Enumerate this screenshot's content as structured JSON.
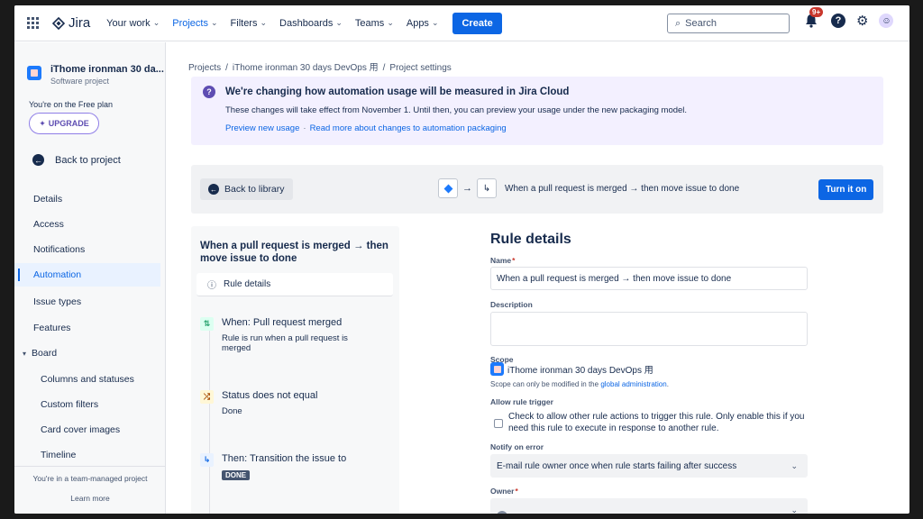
{
  "nav": {
    "logo": "Jira",
    "items": [
      {
        "label": "Your work",
        "active": false
      },
      {
        "label": "Projects",
        "active": true
      },
      {
        "label": "Filters",
        "active": false
      },
      {
        "label": "Dashboards",
        "active": false
      },
      {
        "label": "Teams",
        "active": false
      },
      {
        "label": "Apps",
        "active": false
      }
    ],
    "create": "Create",
    "search_placeholder": "Search",
    "notifications_badge": "9+",
    "help": "?"
  },
  "sidebar": {
    "project_name": "iThome ironman 30 da...",
    "project_type": "Software project",
    "plan_text": "You're on the Free plan",
    "upgrade": "UPGRADE",
    "back_to_project": "Back to project",
    "items": [
      {
        "label": "Details",
        "active": false
      },
      {
        "label": "Access",
        "active": false
      },
      {
        "label": "Notifications",
        "active": false
      },
      {
        "label": "Automation",
        "active": true
      },
      {
        "label": "Issue types",
        "active": false
      },
      {
        "label": "Features",
        "active": false
      },
      {
        "label": "Board",
        "active": false
      },
      {
        "label": "Columns and statuses",
        "active": false
      },
      {
        "label": "Custom filters",
        "active": false
      },
      {
        "label": "Card cover images",
        "active": false
      },
      {
        "label": "Timeline",
        "active": false
      }
    ],
    "footer_text": "You're in a team-managed project",
    "learn_more": "Learn more"
  },
  "breadcrumb": [
    "Projects",
    "iThome ironman 30 days DevOps 用",
    "Project settings"
  ],
  "banner": {
    "title": "We're changing how automation usage will be measured in Jira Cloud",
    "body": "These changes will take effect from November 1. Until then, you can preview your usage under the new packaging model.",
    "link1": "Preview new usage",
    "link2": "Read more about changes to automation packaging"
  },
  "rulebar": {
    "back_to_library": "Back to library",
    "flow_text": "When a pull request is merged → then move issue to done",
    "turn_on": "Turn it on"
  },
  "rule_panel": {
    "title": "When a pull request is merged → then move issue to done",
    "rule_details": "Rule details",
    "steps": [
      {
        "title": "When: Pull request merged",
        "sub": "Rule is run when a pull request is merged"
      },
      {
        "title": "Status does not equal",
        "sub": "Done"
      },
      {
        "title": "Then: Transition the issue to",
        "lozenge": "DONE"
      }
    ]
  },
  "details": {
    "heading": "Rule details",
    "name_label": "Name",
    "name_value": "When a pull request is merged → then move issue to done",
    "description_label": "Description",
    "description_value": "",
    "scope_label": "Scope",
    "scope_value": "iThome ironman 30 days DevOps 用",
    "scope_note": "Scope can only be modified in the",
    "scope_link": "global administration",
    "trigger_label": "Allow rule trigger",
    "trigger_text": "Check to allow other rule actions to trigger this rule. Only enable this if you need this rule to execute in response to another rule.",
    "notify_label": "Notify on error",
    "notify_value": "E-mail rule owner once when rule starts failing after success",
    "owner_label": "Owner"
  }
}
